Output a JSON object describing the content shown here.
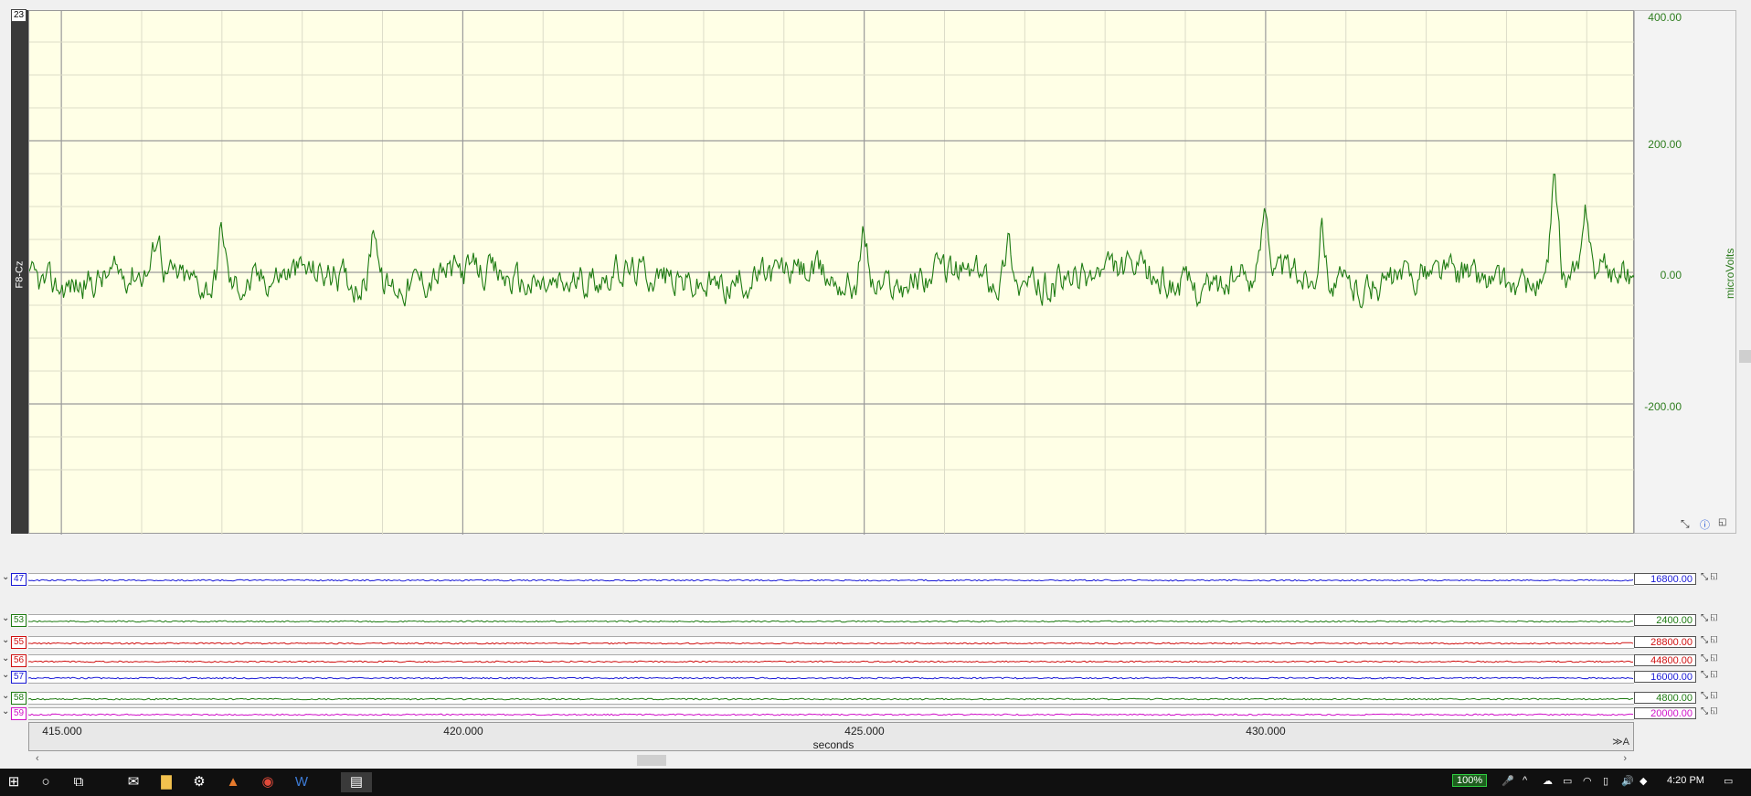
{
  "main_channel": {
    "number": "23",
    "label": "F8-Cz",
    "unit": "microVolts",
    "y_ticks": [
      "400.00",
      "200.00",
      "0.00",
      "-200.00"
    ],
    "trace_color": "#1e7b12",
    "background_color": "#ffffe6"
  },
  "minor_channels": [
    {
      "number": "47",
      "value": "16800.00",
      "color": "#1a1ad6"
    },
    {
      "number": "53",
      "value": "2400.00",
      "color": "#1e7b12"
    },
    {
      "number": "55",
      "value": "28800.00",
      "color": "#d01010"
    },
    {
      "number": "56",
      "value": "44800.00",
      "color": "#d01010"
    },
    {
      "number": "57",
      "value": "16000.00",
      "color": "#1a1ad6"
    },
    {
      "number": "58",
      "value": "4800.00",
      "color": "#1e7b12"
    },
    {
      "number": "59",
      "value": "20000.00",
      "color": "#d010c8"
    }
  ],
  "x_axis": {
    "ticks": [
      "415.000",
      "420.000",
      "425.000",
      "430.000"
    ],
    "unit": "seconds",
    "range": [
      414.6,
      434.6
    ]
  },
  "taskbar": {
    "zoom": "100%",
    "time": "4:20 PM",
    "apps": [
      "start-icon",
      "cortana-icon",
      "task-view-icon",
      "mail-icon",
      "file-explorer-icon",
      "settings-icon",
      "matlab-icon",
      "chrome-icon",
      "word-icon",
      "labchart-icon"
    ]
  }
}
